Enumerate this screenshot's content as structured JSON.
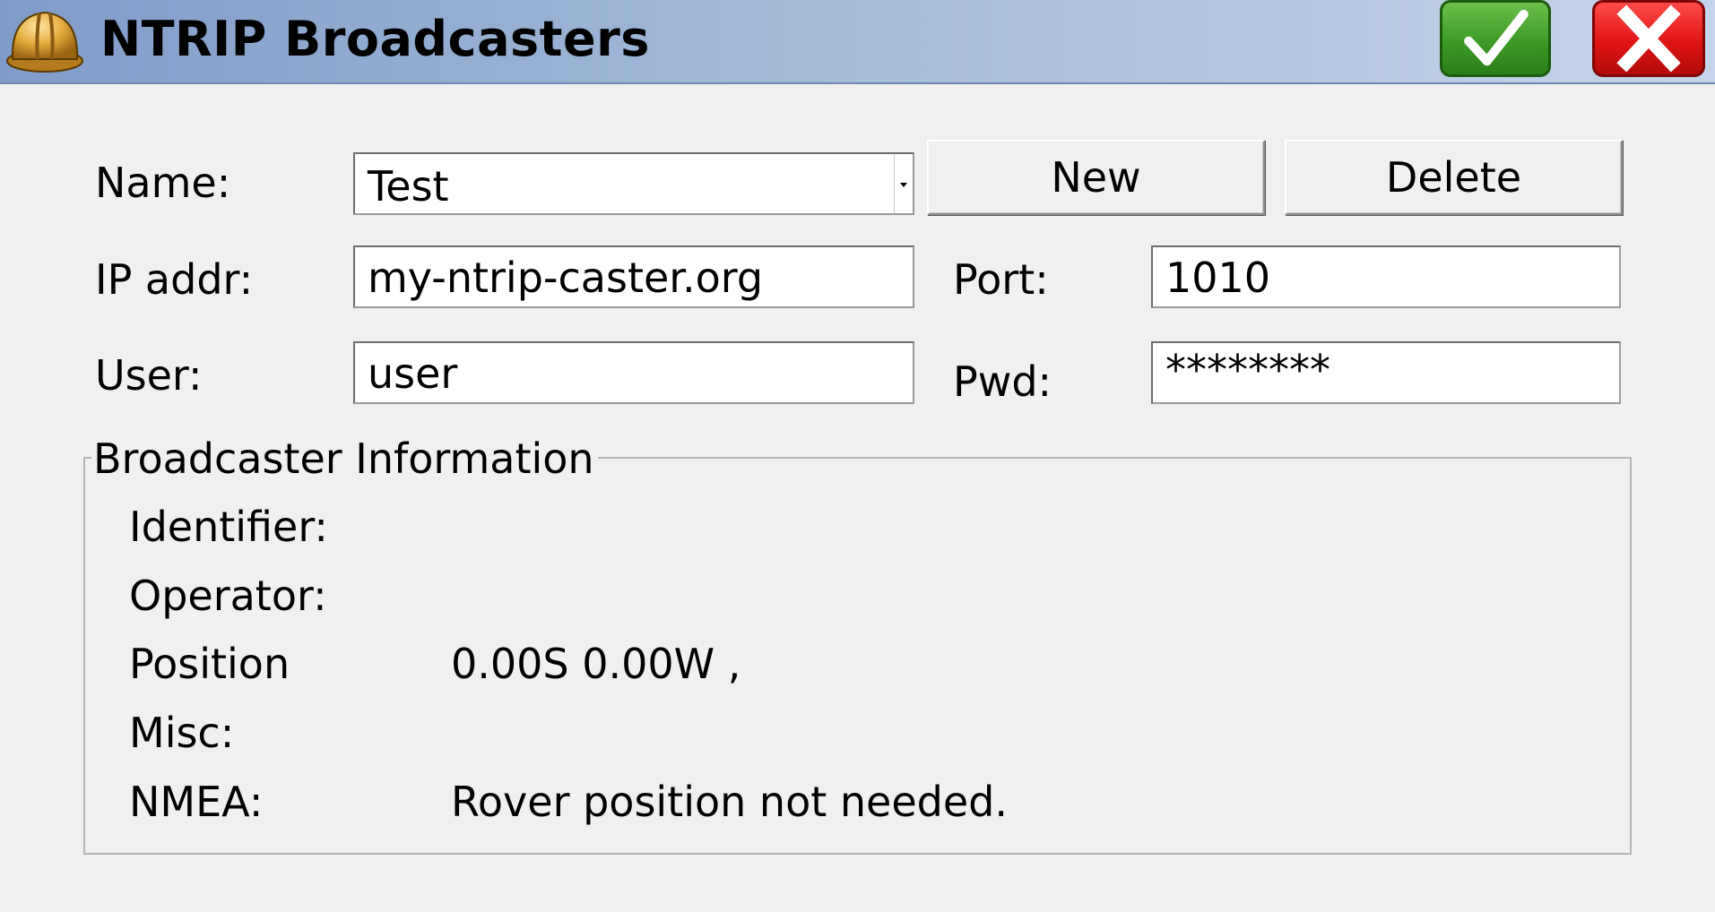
{
  "window": {
    "title": "NTRIP Broadcasters",
    "app_icon": "hard-hat-icon",
    "ok_icon": "checkmark-icon",
    "cancel_icon": "x-icon"
  },
  "form": {
    "name_label": "Name:",
    "name_value": "Test",
    "new_button": "New",
    "delete_button": "Delete",
    "ip_label": "IP addr:",
    "ip_value": "my-ntrip-caster.org",
    "port_label": "Port:",
    "port_value": "1010",
    "user_label": "User:",
    "user_value": "user",
    "pwd_label": "Pwd:",
    "pwd_value": "********"
  },
  "info": {
    "group_title": "Broadcaster Information",
    "identifier_label": "Identifier:",
    "identifier_value": "",
    "operator_label": "Operator:",
    "operator_value": "",
    "position_label": "Position",
    "position_value": "0.00S 0.00W ,",
    "misc_label": "Misc:",
    "misc_value": "",
    "nmea_label": "NMEA:",
    "nmea_value": "Rover position not needed."
  },
  "colors": {
    "titlebar": "#a3b9d8",
    "ok_button": "#3d9a26",
    "cancel_button": "#e01414",
    "background": "#f0f0f0"
  }
}
